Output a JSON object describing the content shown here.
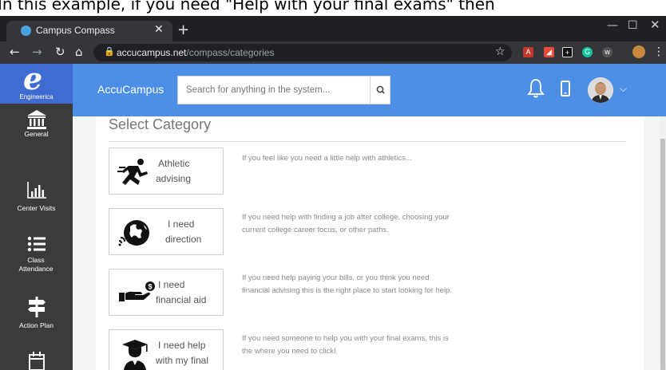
{
  "caption": {
    "text": "In this example, if you need \"Help with your final exams\" then"
  },
  "browser": {
    "tab_title": "Campus Compass",
    "url_host": "accucampus.net",
    "url_path": "/compass/categories"
  },
  "sidebar": {
    "brand_label": "Engineerica",
    "items": [
      {
        "label": "General",
        "icon": "bank-icon"
      },
      {
        "label": "Center Visits",
        "icon": "bar-chart-icon"
      },
      {
        "label": "Class Attendance",
        "icon": "list-icon"
      },
      {
        "label": "Action Plan",
        "icon": "signpost-icon"
      },
      {
        "label": "",
        "icon": "calendar-icon"
      }
    ]
  },
  "header": {
    "app_name": "AccuCampus",
    "search_placeholder": "Search for anything in the system..."
  },
  "main": {
    "title": "Select Category",
    "categories": [
      {
        "label_line1": "Athletic",
        "label_line2": "advising",
        "icon": "running-person-icon",
        "desc_line1": "If you feel like you need a little help with athletics...",
        "desc_line2": ""
      },
      {
        "label_line1": "I need",
        "label_line2": "direction",
        "icon": "globe-icon",
        "desc_line1": "If you need help with finding a job after college, choosing your",
        "desc_line2": "current college career focus, or other paths."
      },
      {
        "label_line1": "I need",
        "label_line2": "financial aid",
        "icon": "hand-money-icon",
        "desc_line1": "If you need help paying your bills, or you think you need",
        "desc_line2": "financial advising this is the right place to start looking for help."
      },
      {
        "label_line1": "I need help",
        "label_line2": "with my final",
        "icon": "graduate-icon",
        "desc_line1": "If you need someone to help you with your final exams, this is",
        "desc_line2": "the where you need to click!"
      }
    ]
  },
  "colors": {
    "header_blue": "#4d8fe6",
    "brand_blue": "#3f6cd1",
    "sidebar_dark": "#3b3b3b"
  }
}
